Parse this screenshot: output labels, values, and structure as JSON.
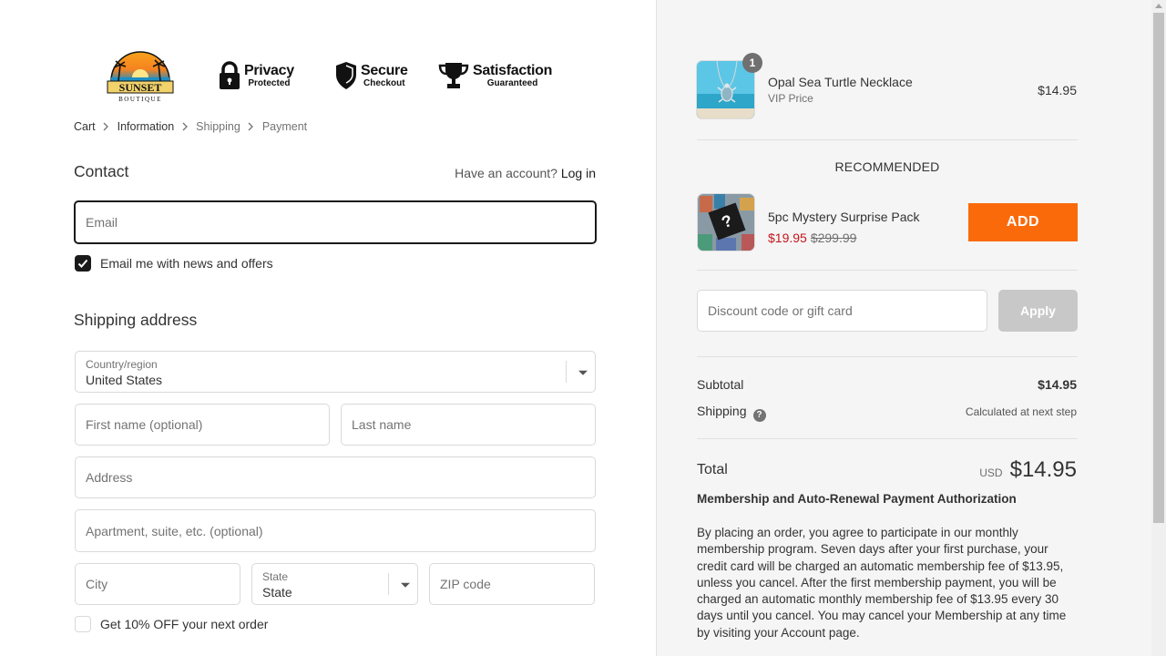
{
  "brand": {
    "logo_text": "SUNSET",
    "logo_sub": "BOUTIQUE"
  },
  "badges": [
    {
      "icon": "padlock-icon",
      "line1": "Privacy",
      "line2": "Protected"
    },
    {
      "icon": "shield-icon",
      "line1": "Secure",
      "line2": "Checkout"
    },
    {
      "icon": "trophy-icon",
      "line1": "Satisfaction",
      "line2": "Guaranteed"
    }
  ],
  "breadcrumb": {
    "cart": "Cart",
    "information": "Information",
    "shipping": "Shipping",
    "payment": "Payment"
  },
  "contact": {
    "title": "Contact",
    "have_account": "Have an account?",
    "login": "Log in",
    "email_placeholder": "Email",
    "news_label": "Email me with news and offers",
    "news_checked": true
  },
  "shipping_address": {
    "title": "Shipping address",
    "country_label": "Country/region",
    "country_value": "United States",
    "first_name_placeholder": "First name (optional)",
    "last_name_placeholder": "Last name",
    "address_placeholder": "Address",
    "apartment_placeholder": "Apartment, suite, etc. (optional)",
    "city_placeholder": "City",
    "state_label": "State",
    "state_value": "State",
    "zip_placeholder": "ZIP code",
    "offer_label": "Get 10% OFF your next order",
    "offer_checked": false
  },
  "summary": {
    "item": {
      "name": "Opal Sea Turtle Necklace",
      "variant": "VIP Price",
      "price": "$14.95",
      "quantity": "1"
    },
    "recommended_title": "RECOMMENDED",
    "recommended": {
      "name": "5pc Mystery Surprise Pack",
      "sale_price": "$19.95",
      "compare_price": "$299.99",
      "add_label": "ADD"
    },
    "discount_placeholder": "Discount code or gift card",
    "apply_label": "Apply",
    "subtotal_label": "Subtotal",
    "subtotal_value": "$14.95",
    "shipping_label": "Shipping",
    "shipping_value": "Calculated at next step",
    "total_label": "Total",
    "currency": "USD",
    "total_value": "$14.95",
    "membership_title": "Membership and Auto-Renewal Payment Authorization",
    "membership_text": "By placing an order, you agree to participate in our monthly membership program. Seven days after your first purchase, your credit card will be charged an automatic membership fee of $13.95, unless you cancel. After the first membership payment, you will be charged an automatic monthly membership fee of $13.95 every 30 days until you cancel. You may cancel your Membership at any time by visiting your Account page."
  },
  "colors": {
    "accent_button": "#fa6a0b",
    "sale_red": "#c4161c",
    "sidebar_bg": "#f5f5f5"
  }
}
